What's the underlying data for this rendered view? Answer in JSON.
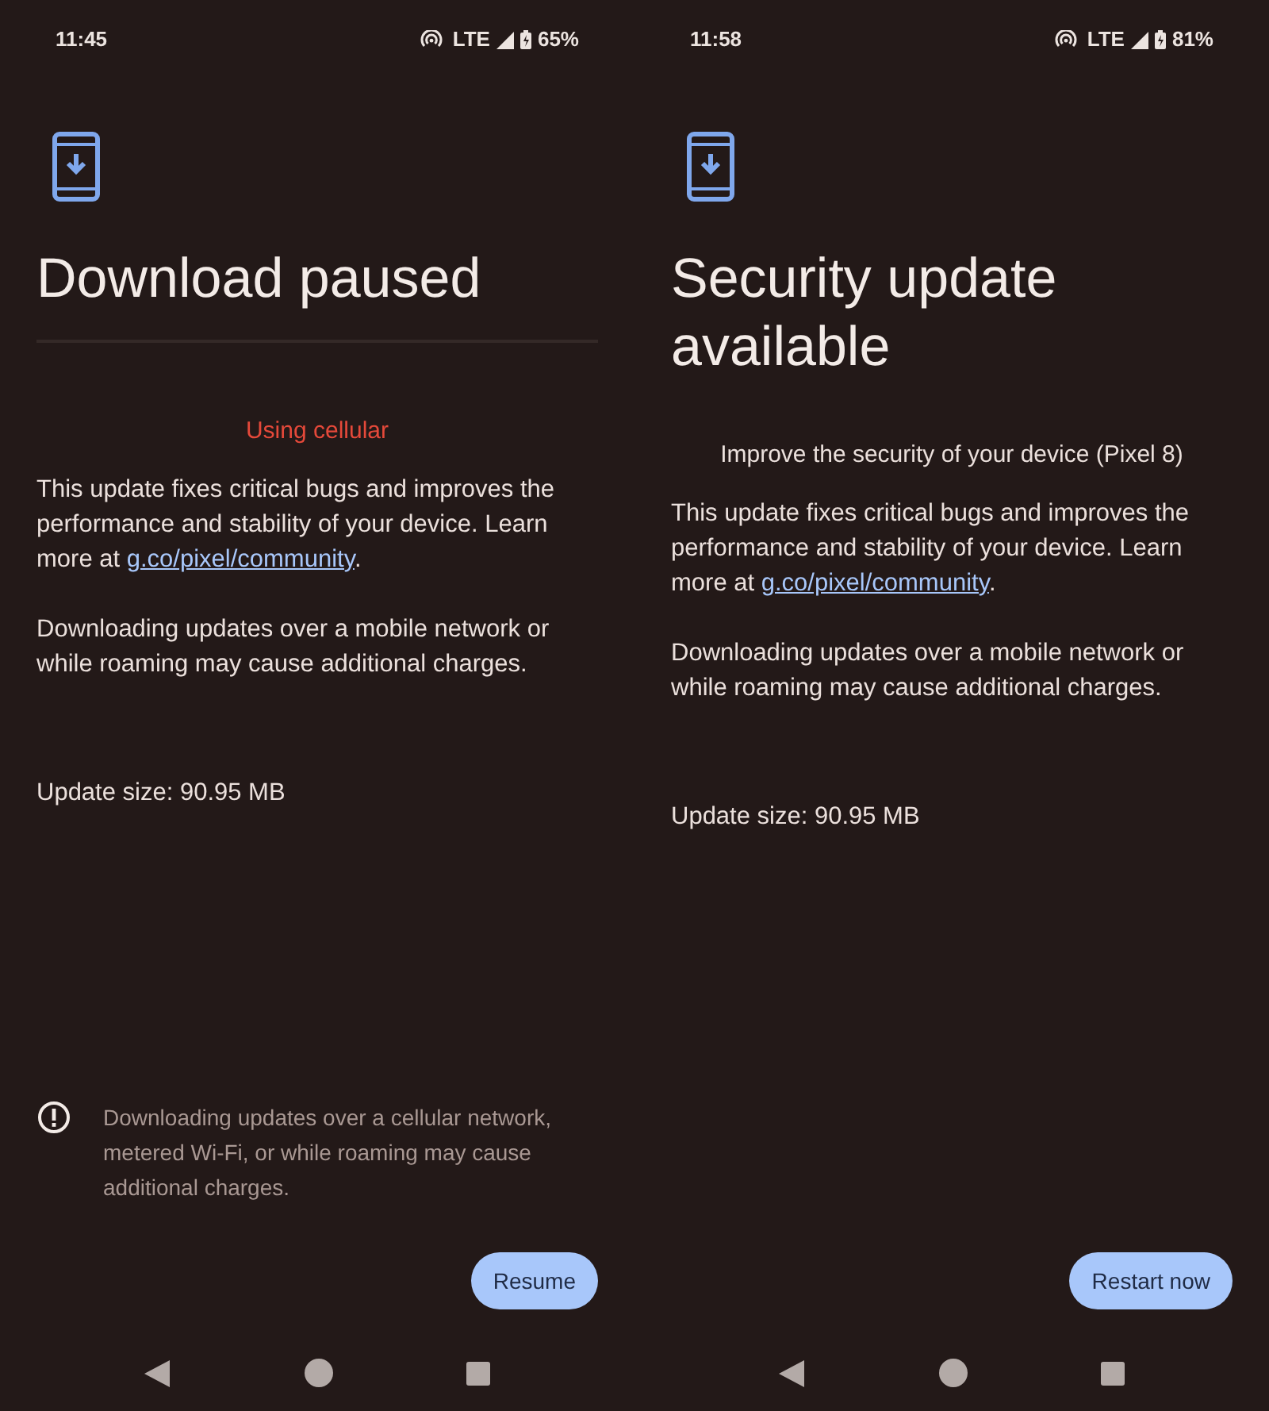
{
  "screens": [
    {
      "status_bar": {
        "time": "11:45",
        "network": "LTE",
        "battery": "65%"
      },
      "title": "Download paused",
      "divider": true,
      "subtitle": {
        "text": "Using cellular",
        "warning": true
      },
      "body": [
        {
          "text": "This update fixes critical bugs and improves the performance and stability of your device. Learn more at ",
          "link": "g.co/pixel/community",
          "after": "."
        },
        {
          "text": "Downloading updates over a mobile network or while roaming may cause additional charges."
        }
      ],
      "update_size": "Update size: 90.95 MB",
      "notice": "Downloading updates over a cellular network, metered Wi-Fi, or while roaming may cause additional charges.",
      "button": "Resume"
    },
    {
      "status_bar": {
        "time": "11:58",
        "network": "LTE",
        "battery": "81%"
      },
      "title": "Security update available",
      "divider": false,
      "subtitle": {
        "text": "Improve the security of your device (Pixel 8)",
        "warning": false
      },
      "body": [
        {
          "text": "This update fixes critical bugs and improves the performance and stability of your device. Learn more at ",
          "link": "g.co/pixel/community",
          "after": "."
        },
        {
          "text": "Downloading updates over a mobile network or while roaming may cause additional charges."
        }
      ],
      "update_size": "Update size: 90.95 MB",
      "button": "Restart now"
    }
  ]
}
